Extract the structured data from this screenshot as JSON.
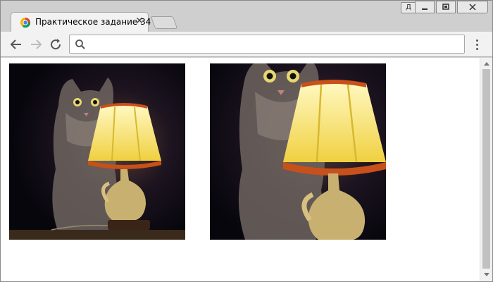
{
  "window": {
    "user_button_label": "Д",
    "minimize_label": "▁",
    "maximize_label": "▢",
    "close_label": "✕"
  },
  "tab": {
    "title": "Практическое задание 34",
    "close_label": "✕"
  },
  "toolbar": {
    "url_value": "",
    "url_placeholder": ""
  },
  "icons": {
    "back": "arrow-left-icon",
    "forward": "arrow-right-icon",
    "reload": "reload-icon",
    "search": "search-icon",
    "menu": "kebab-menu-icon"
  },
  "colors": {
    "lamp_glow": "#fff59a",
    "lamp_fringe": "#c8501a",
    "background_dark": "#0c0a14"
  }
}
